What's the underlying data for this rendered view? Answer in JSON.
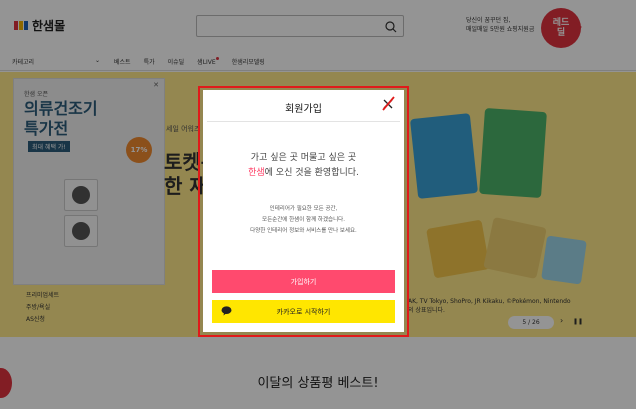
{
  "header": {
    "logo_text": "한샘몰",
    "promo_lines": [
      "당신이 꿈꾸던 집,",
      "매일매일 5만원 쇼핑지원금"
    ],
    "badge_text": "레드\n딜"
  },
  "nav": {
    "category_label": "카테고리",
    "items": [
      "베스트",
      "특가",
      "이슈딜",
      "샘LIVE",
      "한샘리모델링"
    ]
  },
  "side_ad": {
    "small": "한샘 오픈",
    "title_line1": "의류건조기",
    "title_line2": "특가전",
    "chip": "최대 혜택 가!",
    "pct": "17%"
  },
  "banner": {
    "mid_small": "세일 어워즈",
    "mid_line1": "토켓몬",
    "mid_line2": "한 재",
    "left_list": [
      "프리미엄세트",
      "주방/욕실",
      "AS신청"
    ],
    "caption": "AK, TV Tokyo, ShoPro, JR Kikaku, ©Pokémon, Nintendo 의 상표입니다.",
    "pager": "5 / 26",
    "pause": "❚❚"
  },
  "best_title": "이달의 상품평 베스트!",
  "modal": {
    "title": "회원가입",
    "headline_1": "가고 싶은 곳 머물고 싶은 곳",
    "headline_brand": "한샘",
    "headline_2": "에 오신 것을 환영합니다.",
    "desc_lines": [
      "인테리어가 필요한 모든 공간,",
      "모든순간에 한샘이 함께 하겠습니다.",
      "다양한 인테리어 정보와 서비스를 만나 보세요."
    ],
    "join_label": "가입하기",
    "kakao_label": "카카오로 시작하기"
  },
  "colors": {
    "accent": "#ff4a6e",
    "kakao": "#ffe600",
    "highlight": "#e01a1a"
  }
}
